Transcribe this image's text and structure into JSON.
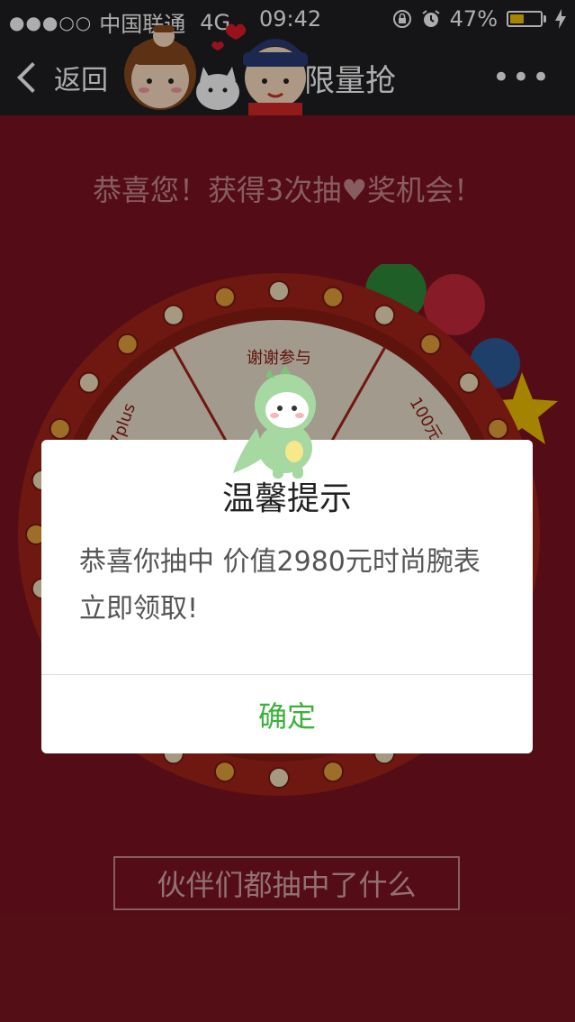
{
  "status_bar": {
    "signal_dots": "●●●○○",
    "carrier": "中国联通",
    "network": "4G",
    "time": "09:42",
    "battery_percent": "47%",
    "battery_level": 0.47,
    "icons": [
      "orientation-lock-icon",
      "alarm-icon",
      "charging-bolt-icon"
    ]
  },
  "nav": {
    "back_label": "返回",
    "title": "限量抢",
    "more_label": "•••"
  },
  "page": {
    "congrats_text": "恭喜您！获得3次抽♥奖机会！",
    "wheel_segments": [
      "谢谢参与",
      "100元",
      "7plus"
    ],
    "friends_button": "伙伴们都抽中了什么"
  },
  "dialog": {
    "title": "温馨提示",
    "message": "恭喜你抽中 价值2980元时尚腕表 立即领取!",
    "confirm_label": "确定"
  },
  "colors": {
    "page_bg": "#7c1421",
    "bar_bg": "#1f1f22",
    "confirm_green": "#3db03d",
    "wheel_rim": "#a3241a"
  }
}
